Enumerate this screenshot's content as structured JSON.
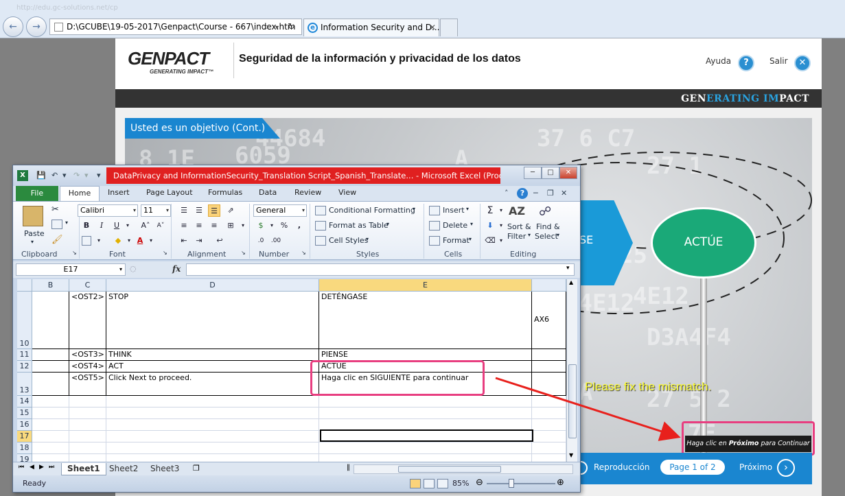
{
  "browser": {
    "address": "D:\\GCUBE\\19-05-2017\\Genpact\\Course - 667\\index.htm",
    "ghost_url": "http://edu.gc-solutions.net/cp",
    "tab_title": "Information Security and D..."
  },
  "course": {
    "logo": "GENPACT",
    "logo_tagline": "GENERATING IMPACT™",
    "title": "Seguridad de la información y privacidad de los datos",
    "help_label": "Ayuda",
    "exit_label": "Salir",
    "band_tagline_1": "GEN",
    "band_tagline_2": "ERATING",
    "band_tagline_3": " IM",
    "band_tagline_4": "PACT",
    "slide_title": "Usted es un objetivo (Cont.)",
    "think_label": "NSE",
    "act_label": "ACTÚE",
    "hint_pre": "Haga clic en ",
    "hint_bold": "Próximo",
    "hint_post": " para Continuar",
    "replay_label": "Reproducción",
    "page_indicator": "Page 1 of 2",
    "next_label": "Próximo",
    "bg_numbers": [
      "44684",
      "6059",
      "37 6 C7",
      "8 1E",
      "27 1",
      "A",
      "25",
      "4E12",
      "44E12",
      "D3A4F4",
      "27 5 2",
      "A3A",
      "7F"
    ]
  },
  "excel": {
    "title": "DataPrivacy and InformationSecurity_Translation Script_Spanish_Translate... - Microsoft Excel (Product ...",
    "tabs": [
      "Home",
      "Insert",
      "Page Layout",
      "Formulas",
      "Data",
      "Review",
      "View"
    ],
    "file_tab": "File",
    "ribbon": {
      "clipboard": {
        "label": "Clipboard",
        "paste": "Paste"
      },
      "font": {
        "label": "Font",
        "name": "Calibri",
        "size": "11"
      },
      "alignment": {
        "label": "Alignment"
      },
      "number": {
        "label": "Number",
        "format": "General"
      },
      "styles": {
        "label": "Styles",
        "conditional": "Conditional Formatting",
        "as_table": "Format as Table",
        "cell_styles": "Cell Styles"
      },
      "cells": {
        "label": "Cells",
        "insert": "Insert",
        "delete": "Delete",
        "format": "Format"
      },
      "editing": {
        "label": "Editing",
        "sort": "Sort &",
        "sort2": "Filter",
        "find": "Find &",
        "find2": "Select"
      }
    },
    "name_box": "E17",
    "columns": [
      "B",
      "C",
      "D",
      "E"
    ],
    "rows": [
      {
        "num": "10",
        "c": "<OST2>",
        "d": "STOP",
        "e": "DETÉNGASE",
        "f": "AX6"
      },
      {
        "num": "11",
        "c": "<OST3>",
        "d": "THINK",
        "e": "PIENSE",
        "f": ""
      },
      {
        "num": "12",
        "c": "<OST4>",
        "d": "ACT",
        "e": "ACTÚE",
        "f": ""
      },
      {
        "num": "13",
        "c": "<OST5>",
        "d": "Click Next to proceed.",
        "e": "Haga clic en SIGUIENTE para continuar",
        "f": ""
      },
      {
        "num": "14",
        "c": "",
        "d": "",
        "e": "",
        "f": ""
      },
      {
        "num": "15",
        "c": "",
        "d": "",
        "e": "",
        "f": ""
      },
      {
        "num": "16",
        "c": "",
        "d": "",
        "e": "",
        "f": ""
      },
      {
        "num": "17",
        "c": "",
        "d": "",
        "e": "",
        "f": ""
      },
      {
        "num": "18",
        "c": "",
        "d": "",
        "e": "",
        "f": ""
      },
      {
        "num": "19",
        "c": "",
        "d": "",
        "e": "",
        "f": ""
      }
    ],
    "sheets": [
      "Sheet1",
      "Sheet2",
      "Sheet3"
    ],
    "status": "Ready",
    "zoom": "85%"
  },
  "annotation": {
    "message": "Please fix the mismatch.",
    "color": "#ffff33",
    "highlight_color": "#e83e80",
    "arrow_color": "#e8201c"
  }
}
